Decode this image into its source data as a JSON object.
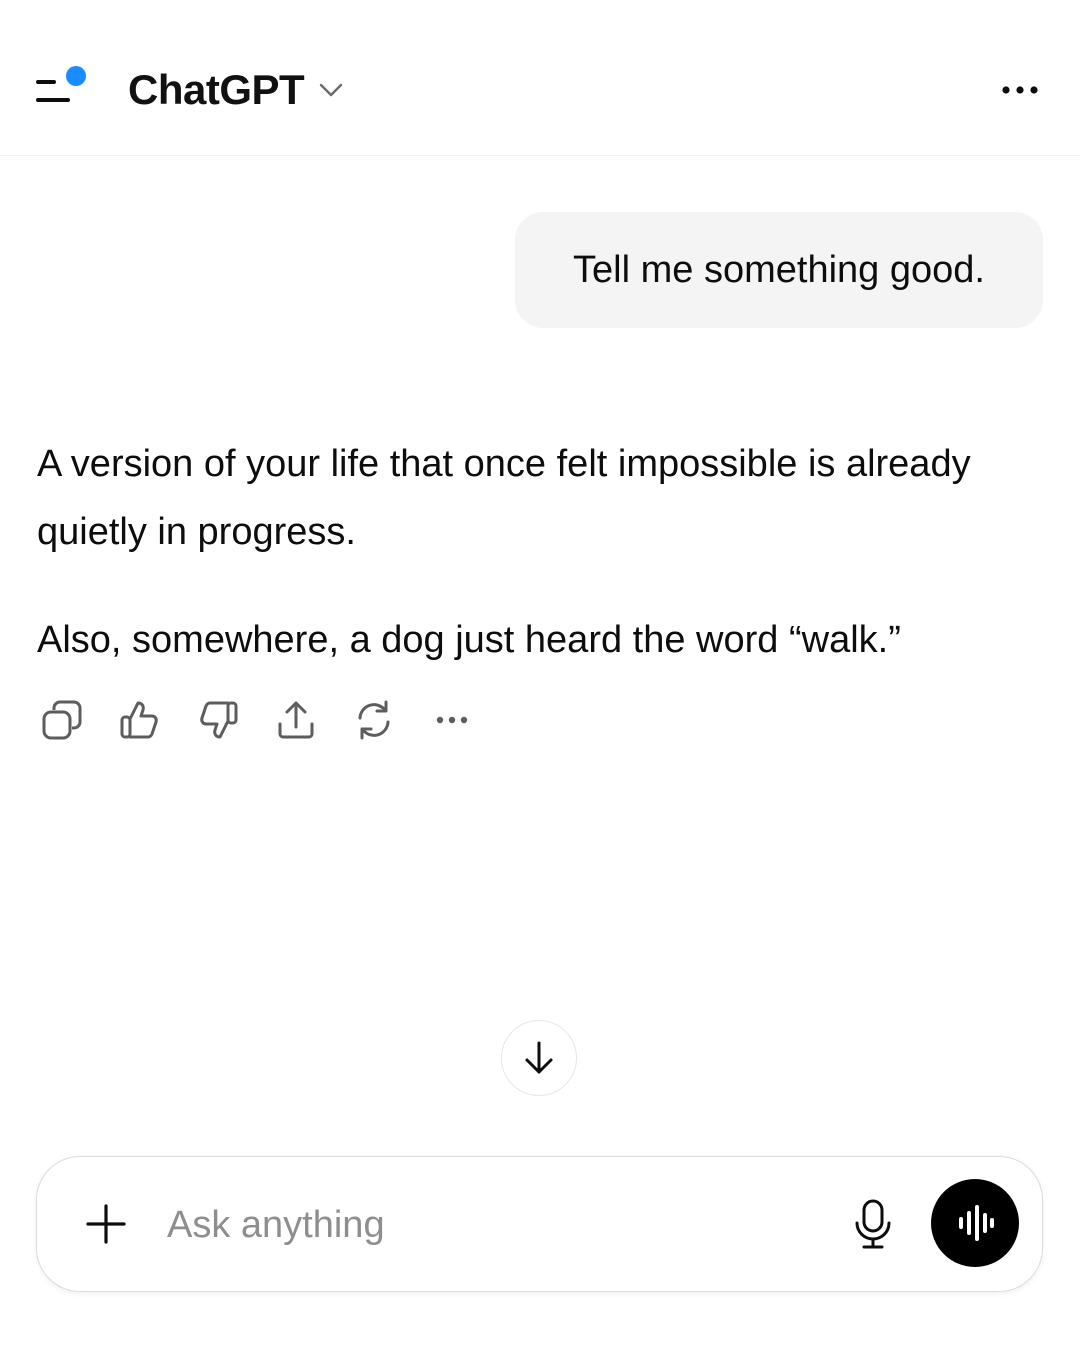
{
  "header": {
    "title": "ChatGPT",
    "sidebar_icon": "sidebar-menu-icon",
    "notification_color": "#1a8cff",
    "title_chevron_icon": "chevron-down-icon",
    "more_icon": "ellipsis-icon"
  },
  "conversation": {
    "user_message": "Tell me something good.",
    "assistant_paragraphs": [
      "A version of your life that once felt impossible is already quietly in progress.",
      "Also, somewhere, a dog just heard the word “walk.”"
    ],
    "actions": [
      {
        "icon": "copy-icon"
      },
      {
        "icon": "thumbs-up-icon"
      },
      {
        "icon": "thumbs-down-icon"
      },
      {
        "icon": "share-icon"
      },
      {
        "icon": "regenerate-icon"
      },
      {
        "icon": "more-actions-icon"
      }
    ]
  },
  "scroll_down_icon": "arrow-down-icon",
  "composer": {
    "placeholder": "Ask anything",
    "value": "",
    "plus_icon": "plus-icon",
    "mic_icon": "microphone-icon",
    "voice_icon": "voice-mode-icon"
  },
  "colors": {
    "background": "#ffffff",
    "text": "#0d0d0d",
    "user_bubble": "#f4f4f4",
    "placeholder": "#8e8e8e",
    "voice_button": "#000000",
    "accent": "#1a8cff"
  }
}
